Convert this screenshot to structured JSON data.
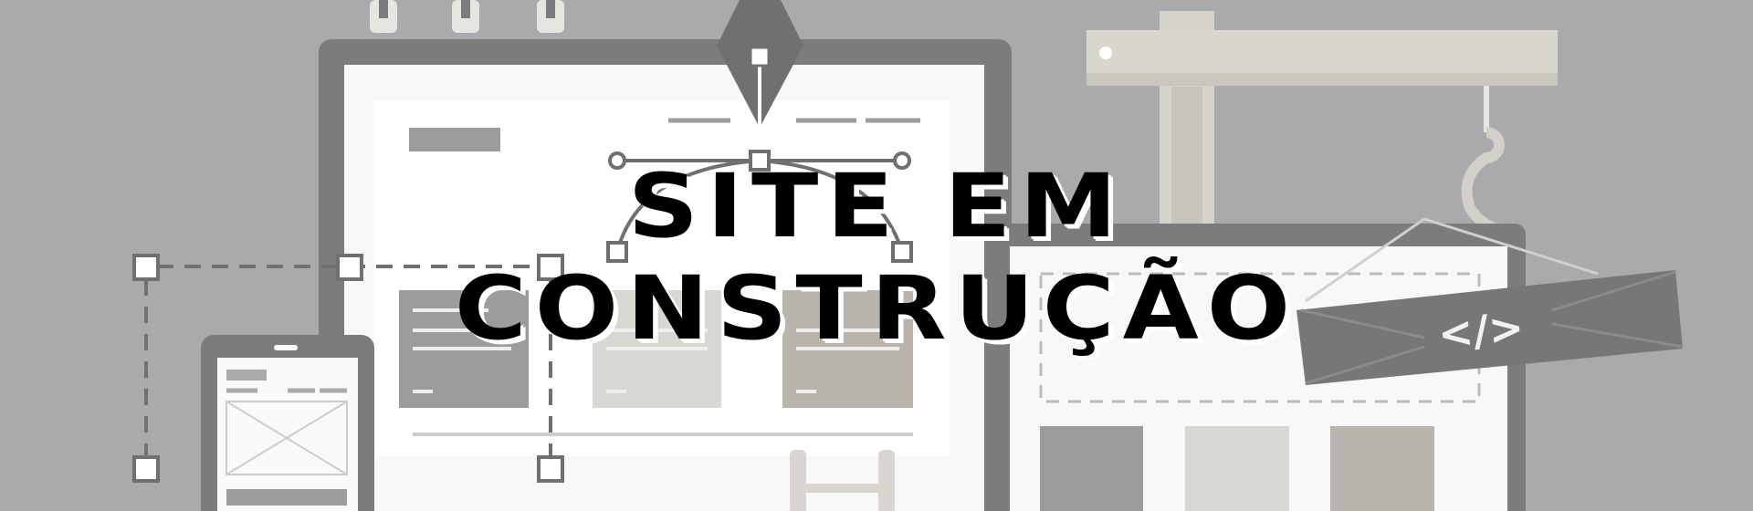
{
  "banner": {
    "title_line1": "SITE EM",
    "title_line2": "CONSTRUÇÃO",
    "code_tag": "</>"
  },
  "colors": {
    "background": "#a9aaac",
    "frame": "#7b7c7d",
    "screen": "#f7f7f7",
    "card_dark": "#9a9c9d",
    "card_light": "#d8d7d2",
    "card_taupe": "#b9b4ae",
    "title_text": "#000000",
    "title_shadow": "#ffffff"
  },
  "icons": [
    "pen-tool-icon",
    "crane-icon",
    "hook-icon",
    "code-icon",
    "tablet-icon",
    "selection-handles-icon"
  ]
}
